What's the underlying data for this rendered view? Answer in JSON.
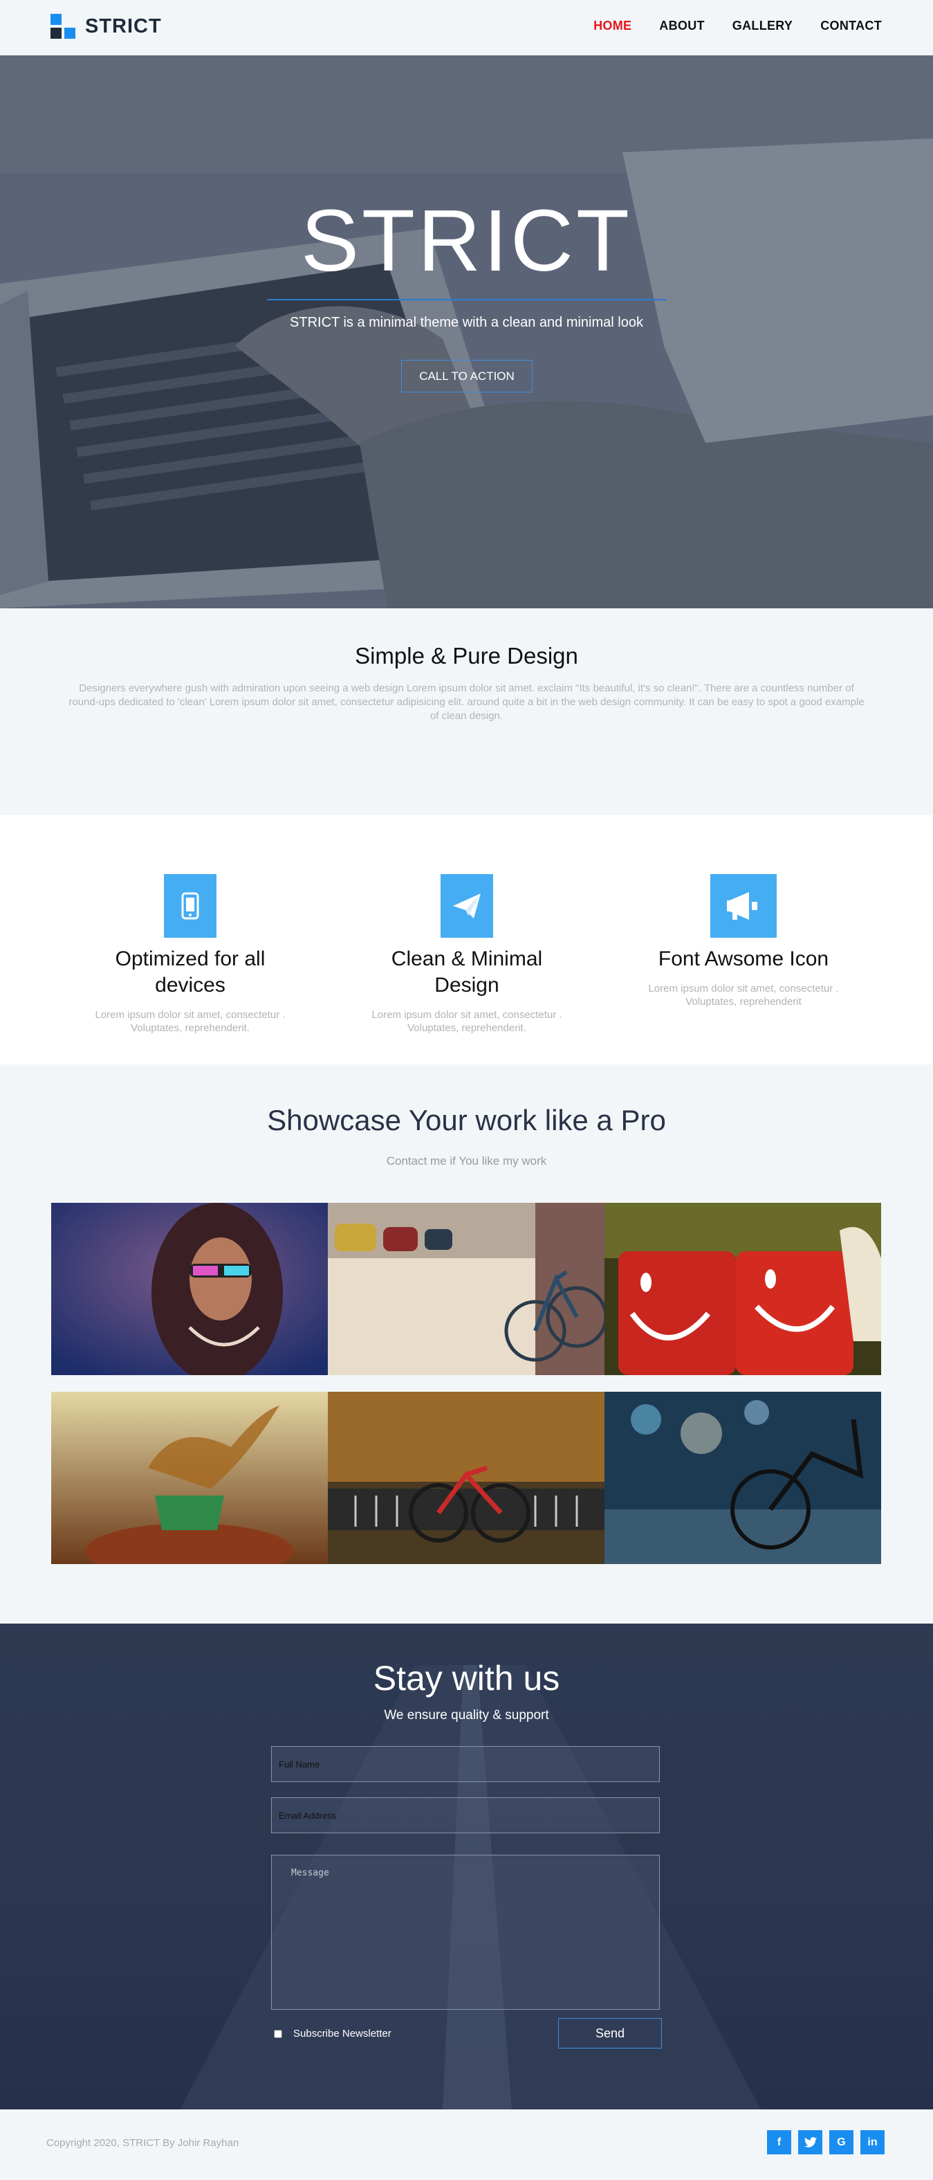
{
  "nav": {
    "brand": "STRICT",
    "logo_colors": [
      "#1a8ef0",
      "#1f2b3b",
      "#1f2b3b",
      "#1a8ef0"
    ],
    "items": [
      {
        "label": "HOME",
        "active": true
      },
      {
        "label": "ABOUT",
        "active": false
      },
      {
        "label": "GALLERY",
        "active": false
      },
      {
        "label": "CONTACT",
        "active": false
      }
    ]
  },
  "hero": {
    "title": "STRICT",
    "subtitle": "STRICT is a minimal theme with a clean and minimal look",
    "cta_label": "CALL TO ACTION"
  },
  "intro": {
    "title": "Simple & Pure Design",
    "text": "Designers everywhere gush with admiration upon seeing a web design Lorem ipsum dolor sit amet. exclaim \"Its beautiful, it's so clean!\". There are a countless number of round-ups dedicated to 'clean' Lorem ipsum dolor sit amet, consectetur adipisicing elit. around quite a bit in the web design community. It can be easy to spot a good example of clean design."
  },
  "features": [
    {
      "icon": "mobile-phone-icon",
      "title": "Optimized for all devices",
      "text": "Lorem ipsum dolor sit amet, consectetur . Voluptates, reprehenderit."
    },
    {
      "icon": "paper-plane-icon",
      "title": "Clean & Minimal Design",
      "text": "Lorem ipsum dolor sit amet, consectetur . Voluptates, reprehenderit."
    },
    {
      "icon": "bullhorn-icon",
      "title": "Font Awsome Icon",
      "text": "Lorem ipsum dolor sit amet, consectetur . Voluptates, reprehenderit"
    }
  ],
  "showcase": {
    "title": "Showcase Your work like a Pro",
    "subtitle": "Contact me if You like my work"
  },
  "contact": {
    "title": "Stay with us",
    "subtitle": "We ensure quality & support",
    "name_placeholder": "Full Name",
    "email_placeholder": "Email Address",
    "message_placeholder": "Message",
    "newsletter_label": "Subscribe Newsletter",
    "send_label": "Send"
  },
  "footer": {
    "copyright": "Copyright 2020, STRICT By Johir Rayhan",
    "social": [
      "f",
      "t",
      "G",
      "in"
    ]
  },
  "colors": {
    "accent": "#1a8ef0",
    "active_nav": "#e8141b",
    "feature_icon_bg": "#45adf2",
    "dark_section": "#2b3650"
  }
}
